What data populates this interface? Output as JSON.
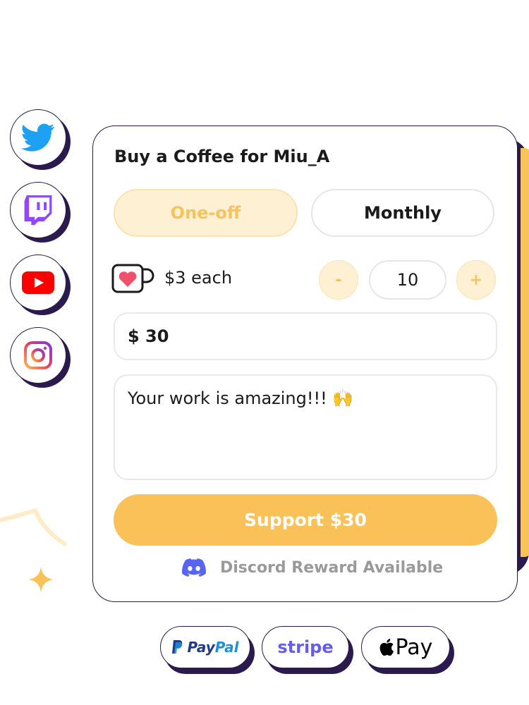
{
  "social": [
    {
      "name": "twitter-icon",
      "color": "#1da1f2"
    },
    {
      "name": "twitch-icon",
      "color": "#9146ff"
    },
    {
      "name": "youtube-icon",
      "color": "#ff0000"
    },
    {
      "name": "instagram-icon",
      "color": "#e4405f"
    }
  ],
  "card": {
    "title": "Buy a Coffee for Miu_A",
    "frequency": {
      "options": [
        "One-off",
        "Monthly"
      ],
      "selected": "One-off"
    },
    "unit_price_label": "$3 each",
    "decrement_label": "-",
    "increment_label": "+",
    "quantity": "10",
    "amount": "$ 30",
    "message": "Your work is amazing!!! 🙌",
    "support_button": "Support $30",
    "discord_note": "Discord Reward Available"
  },
  "payment_methods": [
    {
      "name": "paypal",
      "label_a": "Pay",
      "label_b": "Pal"
    },
    {
      "name": "stripe",
      "label": "stripe"
    },
    {
      "name": "apple-pay",
      "label": "Pay"
    }
  ],
  "colors": {
    "accent": "#f9c157",
    "accent_light": "#fdf0d3",
    "outline": "#2b1a4e",
    "discord": "#5865f2"
  }
}
